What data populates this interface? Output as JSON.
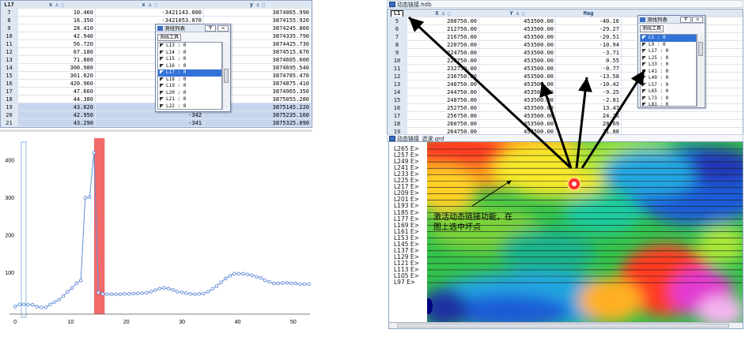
{
  "left_grid": {
    "columns": [
      "L17",
      "x",
      "x",
      "y"
    ],
    "sort_marks": [
      "",
      "∆ □",
      "∆ □",
      "∆ □"
    ],
    "rows": [
      [
        "7",
        "10.460",
        "-3421143.000",
        "3874065.990"
      ],
      [
        "8",
        "16.350",
        "-3421053.070",
        "3874155.920"
      ],
      [
        "9",
        "28.410",
        "-3420963.130",
        "3874245.860"
      ],
      [
        "10",
        "42.940",
        "-342",
        "3874335.790"
      ],
      [
        "11",
        "56.720",
        "-342",
        "3874425.730"
      ],
      [
        "12",
        "67.180",
        "-342",
        "3874515.670"
      ],
      [
        "13",
        "71.800",
        "-342",
        "3874605.600"
      ],
      [
        "14",
        "300.980",
        "-342",
        "3874695.540"
      ],
      [
        "15",
        "301.620",
        "-342",
        "3874785.470"
      ],
      [
        "16",
        "420.960",
        "-342",
        "3874875.410"
      ],
      [
        "17",
        "47.660",
        "-342",
        "3874965.350"
      ],
      [
        "18",
        "44.380",
        "-342",
        "3875055.280"
      ],
      [
        "19",
        "43.020",
        "-342",
        "3875145.220"
      ],
      [
        "20",
        "42.950",
        "-342",
        "3875235.160"
      ],
      [
        "21",
        "43.290",
        "-341",
        "3875325.090"
      ],
      [
        "22",
        "43.060",
        "-341",
        "3875415.030"
      ],
      [
        "23",
        "44.580",
        "-341",
        "3875504.960"
      ],
      [
        "24",
        "45.220",
        "-341",
        "3875594.900"
      ],
      [
        "25",
        "45.660",
        "-341",
        "3875684.840"
      ],
      [
        "26",
        "46.010",
        "-3419434.210",
        "3875774.770"
      ],
      [
        "27",
        "46.780",
        "-3419344.280",
        "3875864.710"
      ]
    ],
    "selected_rows": [
      12,
      13,
      14
    ]
  },
  "left_popup": {
    "title": "测线列表",
    "pin": "∇",
    "close": "☒",
    "tool_button": "测线工具",
    "items": [
      "L13 : 0",
      "L14 : 0",
      "L15 : 0",
      "L16 : 0",
      "L17 : 0",
      "L18 : 0",
      "L19 : 0",
      "L20 : 0",
      "L21 : 0",
      "L22 : 0",
      "L23 : 0",
      "L24 : 0"
    ],
    "selected": 4
  },
  "chart_data": {
    "type": "line",
    "x": [
      0,
      1,
      2,
      3,
      4,
      5,
      6,
      7,
      8,
      9,
      10,
      11,
      12,
      13,
      14,
      15,
      16,
      17,
      18,
      19,
      20,
      21,
      22,
      23,
      24,
      25,
      26,
      27,
      28,
      29,
      30,
      31,
      32,
      33,
      34,
      35,
      36,
      37,
      38,
      39,
      40,
      41,
      42,
      43,
      44,
      45,
      46,
      47,
      48,
      49,
      50,
      51,
      52,
      53,
      54
    ],
    "series": [
      {
        "values": [
          10,
          16,
          16,
          15,
          15,
          10,
          8,
          8,
          16,
          22,
          28,
          38,
          50,
          60,
          72,
          80,
          301,
          302,
          421,
          48,
          44,
          43,
          43,
          43,
          43,
          44,
          44,
          45,
          45,
          46,
          47,
          50,
          54,
          58,
          60,
          58,
          55,
          50,
          48,
          46,
          44,
          43,
          44,
          45,
          50,
          57,
          65,
          75,
          85,
          92,
          98,
          98,
          98,
          96,
          94,
          90,
          87,
          80,
          76,
          72,
          72,
          73,
          74,
          72,
          72,
          70,
          70,
          70
        ]
      }
    ],
    "highlight_x_range": [
      14.2,
      16.1
    ],
    "xlim": [
      -1,
      53
    ],
    "ylim": [
      -10,
      460
    ],
    "xticks": [
      0,
      10,
      20,
      30,
      40,
      50
    ],
    "yticks": [
      100,
      200,
      300,
      400
    ],
    "grid": false,
    "colors": {
      "line": "#5f8fd6",
      "marker": "#4f7fd0",
      "highlight": "#f26a6a"
    }
  },
  "right_window": {
    "title": "动态链接.hdb",
    "columns": [
      "L1",
      "X",
      "Y",
      "Mag"
    ],
    "sort_marks": [
      "",
      "∆ □",
      "∆ □",
      ""
    ],
    "rows": [
      [
        "5",
        "208750.00",
        "453500.00",
        "-40.16"
      ],
      [
        "6",
        "212750.00",
        "453500.00",
        "-29.27"
      ],
      [
        "7",
        "216750.00",
        "453500.00",
        "-20.51"
      ],
      [
        "8",
        "220750.00",
        "453500.00",
        "-10.94"
      ],
      [
        "9",
        "224750.00",
        "453500.00",
        "-3.71"
      ],
      [
        "10",
        "228750.00",
        "453500.00",
        "0.55"
      ],
      [
        "11",
        "232750.00",
        "453500.00",
        "-0.77"
      ],
      [
        "12",
        "236750.00",
        "453500.00",
        "-13.58"
      ],
      [
        "13",
        "240750.00",
        "453500.00",
        "-10.42"
      ],
      [
        "14",
        "244750.00",
        "453500.00",
        "-9.25"
      ],
      [
        "15",
        "248750.00",
        "453500.00",
        "-2.81"
      ],
      [
        "16",
        "252750.00",
        "453500.00",
        "13.47"
      ],
      [
        "17",
        "256750.00",
        "453500.00",
        "24.26"
      ],
      [
        "18",
        "260750.00",
        "453500.00",
        "28.69"
      ],
      [
        "19",
        "264750.00",
        "453500.00",
        "21.88"
      ],
      [
        "20",
        "268750.00",
        "453500.00",
        "19.22"
      ],
      [
        "21",
        "272750.00",
        "453500.00",
        "6.72"
      ],
      [
        "22",
        "276750.00",
        "453500.00",
        "-5.78"
      ]
    ]
  },
  "right_popup": {
    "title": "测线列表",
    "pin": "∇",
    "close": "☒",
    "tool_button": "测线工具",
    "items": [
      "L1 : 0",
      "L9 : 0",
      "L17 : 0",
      "L25 : 0",
      "L33 : 0",
      "L41 : 0",
      "L49 : 0",
      "L57 : 0",
      "L65 : 0",
      "L73 : 0",
      "L81 : 0"
    ],
    "selected": 0
  },
  "map_window": {
    "title": "动态链接_滤波.grd",
    "line_labels": [
      "L265 E>",
      "L257 E>",
      "L249 E>",
      "L241 E>",
      "L233 E>",
      "L225 E>",
      "L217 E>",
      "L209 E>",
      "L201 E>",
      "L193 E>",
      "L185 E>",
      "L177 E>",
      "L169 E>",
      "L161 E>",
      "L153 E>",
      "L145 E>",
      "L137 E>",
      "L129 E>",
      "L121 E>",
      "L113 E>",
      "L105 E>",
      "L97 E>"
    ],
    "annotation_line1": "激活动态链接功能，在",
    "annotation_line2": "图上选中坏点"
  }
}
